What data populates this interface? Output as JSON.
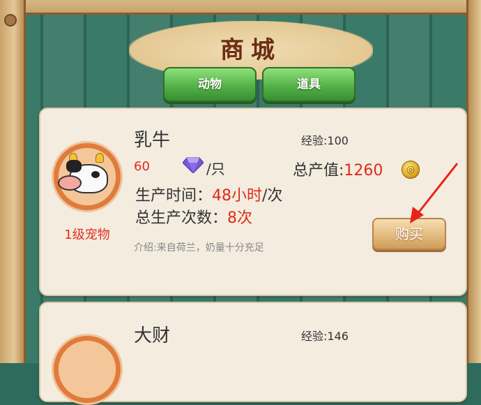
{
  "shop": {
    "title": "商城",
    "tabs": [
      {
        "label": "动物",
        "active": true
      },
      {
        "label": "道具",
        "active": false
      }
    ]
  },
  "items": [
    {
      "name": "乳牛",
      "level_label": "1级宠物",
      "exp": "经验:100",
      "price": "60",
      "per_unit": "/只",
      "total_label": "总产值:",
      "total_value": "1260",
      "production_time_label": "生产时间：",
      "production_time_value": "48小时",
      "production_time_unit": "/次",
      "production_count_label": "总生产次数：",
      "production_count_value": "8次",
      "intro": "介绍:来自荷兰，奶量十分充足",
      "buy_label": "购买"
    },
    {
      "name": "大财",
      "exp": "经验:146"
    }
  ],
  "colors": {
    "accent_red": "#e02a1a",
    "tab_green": "#4fae44",
    "buy_tan": "#e2b77a",
    "title_brown": "#6b2d14"
  },
  "icons": [
    "diamond-icon",
    "gold-coin-icon",
    "cow-pet-icon",
    "red-arrow-icon"
  ]
}
